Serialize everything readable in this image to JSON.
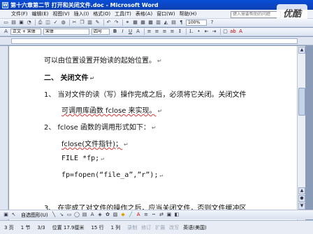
{
  "window": {
    "title": "第十六章第二节 打开和关闭文件.doc - Microsoft Word"
  },
  "menubar": {
    "items": [
      "文件(F)",
      "编辑(E)",
      "视图(V)",
      "插入(I)",
      "格式(O)",
      "工具(T)",
      "表格(A)",
      "窗口(W)",
      "帮助(H)"
    ]
  },
  "help": {
    "placeholder": "键入需要帮助的问题"
  },
  "toolbar": {
    "zoom": "100%",
    "style": "正文 + 宋体",
    "font": "宋体",
    "size": "四号"
  },
  "document": {
    "lines": [
      "可以由位置设置开始读的起始位置。",
      "二、 关闭文件",
      "1、    当对文件的读（写）操作完成之后，必须将它关闭。关闭文件",
      "可调用库函数 fclose 来实现。",
      "2、    fclose 函数的调用形式如下：",
      "fclose(文件指针)；",
      "FILE *fp;",
      "fp=fopen(“file_a”,”r”);",
      "3、    在完成了对文件的操作之后，应当关闭文件，否则文件缓冲区"
    ],
    "para_mark": "↵"
  },
  "drawbar": {
    "autoshapes": "自选图形(U)"
  },
  "status": {
    "page": "3 页",
    "section": "1 节",
    "pages": "3/3",
    "position": "位置 17.9厘米",
    "line": "15 行",
    "column": "1 列",
    "modes": [
      "录制",
      "修订",
      "扩展",
      "改写"
    ],
    "language": "英语(美国)"
  }
}
